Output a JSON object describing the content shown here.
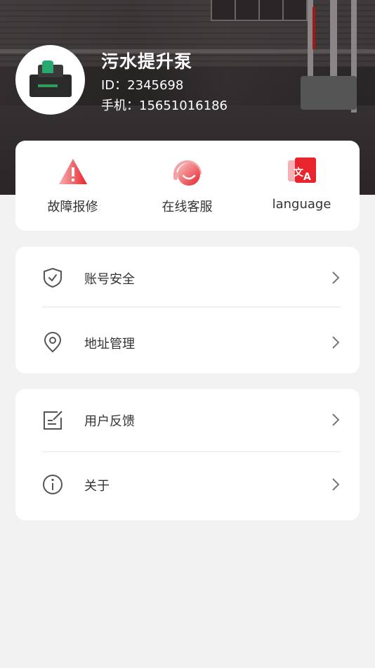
{
  "profile": {
    "name": "污水提升泵",
    "id_text": "ID：2345698",
    "phone_text": "手机：15651016186"
  },
  "quick_actions": [
    {
      "label": "故障报修",
      "icon": "warning-icon"
    },
    {
      "label": "在线客服",
      "icon": "headset-icon"
    },
    {
      "label": "language",
      "icon": "translate-icon"
    }
  ],
  "menu_group_1": [
    {
      "label": "账号安全",
      "icon": "shield-check-icon"
    },
    {
      "label": "地址管理",
      "icon": "location-pin-icon"
    }
  ],
  "menu_group_2": [
    {
      "label": "用户反馈",
      "icon": "feedback-edit-icon"
    },
    {
      "label": "关于",
      "icon": "info-icon"
    }
  ],
  "colors": {
    "accent_red": "#e8242c",
    "background": "#f2f2f2",
    "card": "#ffffff",
    "text": "#333333",
    "icon_gray": "#555555"
  }
}
